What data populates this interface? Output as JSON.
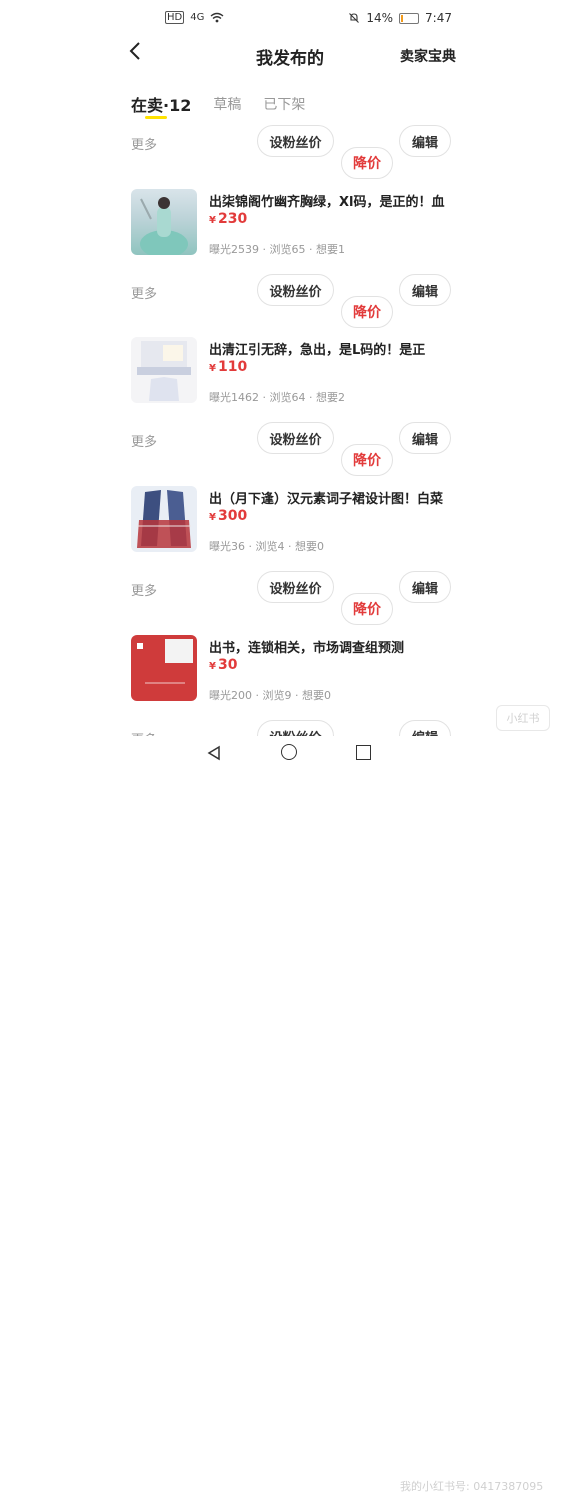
{
  "status_bar": {
    "left_icons": [
      "HD",
      "4G",
      "wifi-icon"
    ],
    "mute_icon": "bell-off-icon",
    "battery": "14%",
    "battery_level": 0.14,
    "time": "7:47"
  },
  "nav": {
    "back_icon": "chevron-left-icon",
    "title": "我发布的",
    "right_link": "卖家宝典"
  },
  "tabs": [
    {
      "label": "在卖·12",
      "active": true
    },
    {
      "label": "草稿",
      "active": false
    },
    {
      "label": "已下架",
      "active": false
    }
  ],
  "action_labels": {
    "more": "更多",
    "set_fans_price": "设粉丝价",
    "lower_price": "降价",
    "edit": "编辑"
  },
  "items": [
    {
      "title": "出柒锦阁竹幽齐胸绿，Xl码，是正的！血",
      "currency": "¥",
      "price": "230",
      "stats": "曝光2539 · 浏览65 · 想要1"
    },
    {
      "title": "出清江引无辞，急出，是L码的！是正",
      "currency": "¥",
      "price": "110",
      "stats": "曝光1462 · 浏览64 · 想要2"
    },
    {
      "title": "出（月下逢）汉元素词子裙设计图！白菜",
      "currency": "¥",
      "price": "300",
      "stats": "曝光36 · 浏览4 · 想要0"
    },
    {
      "title": "出书，连锁相关，市场调查组预测",
      "currency": "¥",
      "price": "30",
      "stats": "曝光200 · 浏览9 · 想要0"
    }
  ],
  "watermark": {
    "logo": "小红书",
    "text": "我的小红书号: 0417387095"
  },
  "colors": {
    "accent_underline": "#ffe200",
    "price": "#e23b3b"
  }
}
